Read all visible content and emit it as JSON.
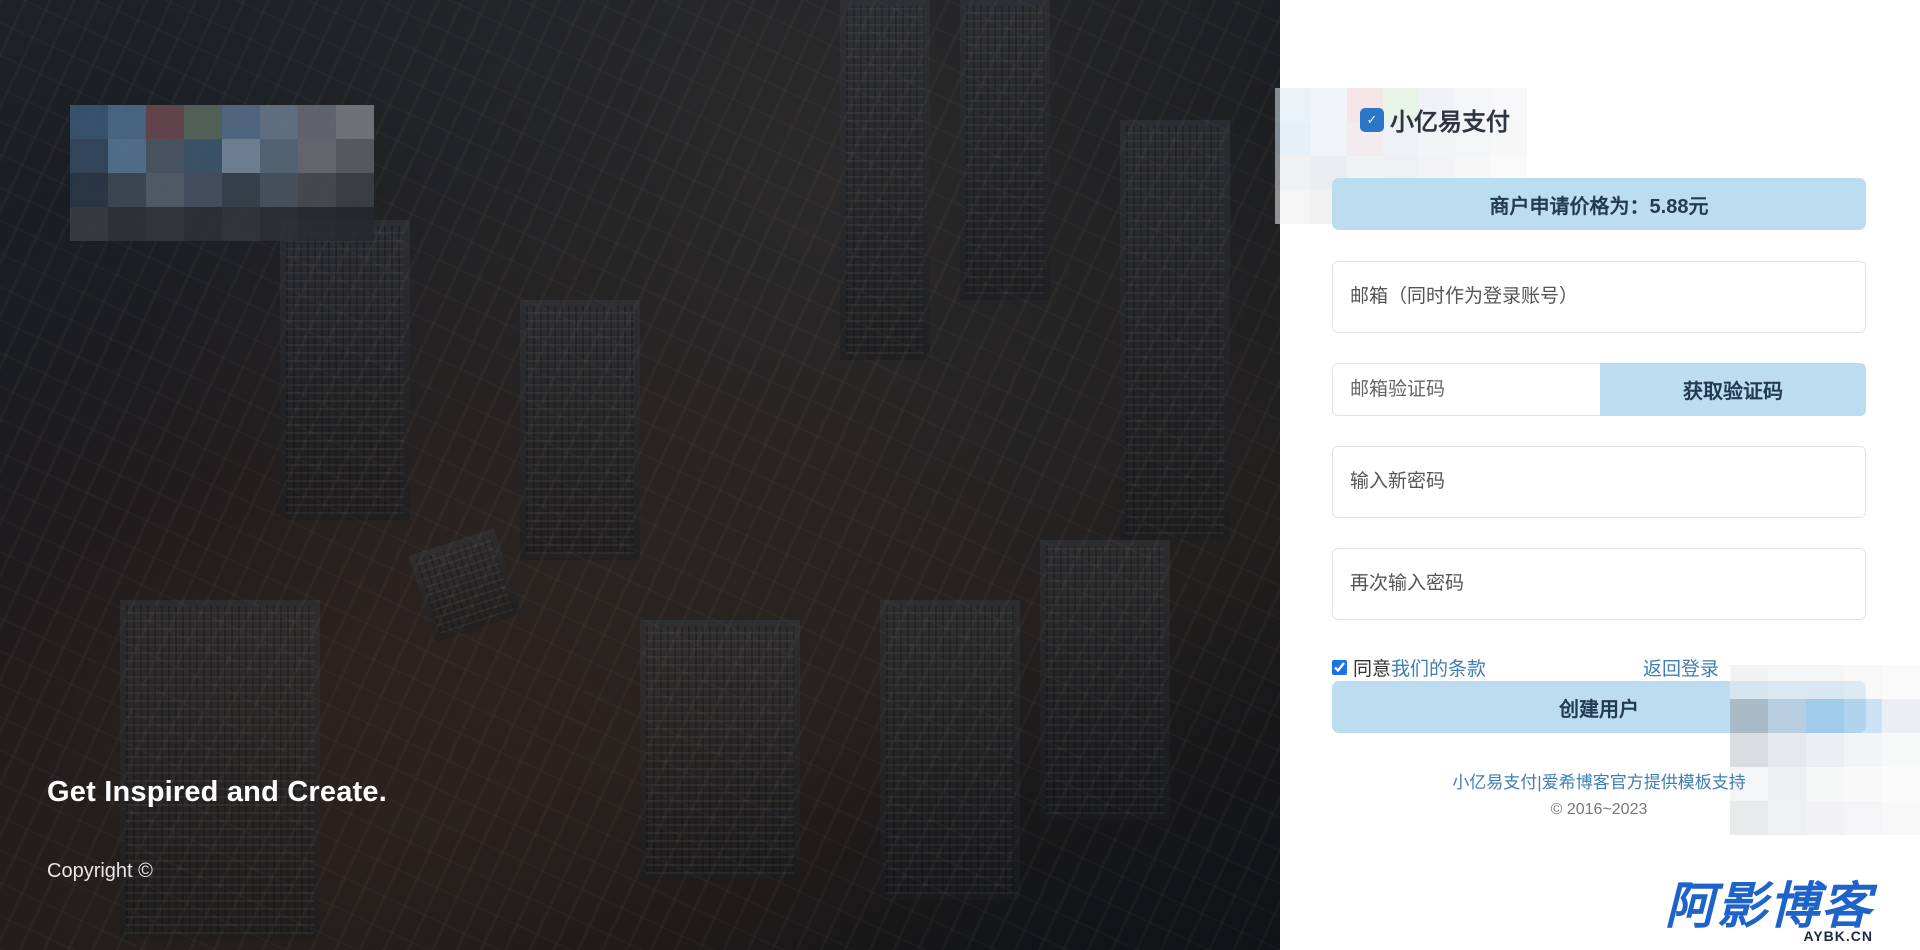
{
  "hero": {
    "tagline": "Get Inspired and Create.",
    "copyright": "Copyright ©"
  },
  "brand": {
    "name": "小亿易支付",
    "icon": "shield-icon"
  },
  "notice": "商户申请价格为：5.88元",
  "form": {
    "email_placeholder": "邮箱（同时作为登录账号）",
    "code_placeholder": "邮箱验证码",
    "get_code_label": "获取验证码",
    "new_password_placeholder": "输入新密码",
    "confirm_password_placeholder": "再次输入密码",
    "agree_text": "同意",
    "terms_link": "我们的条款",
    "back_login": "返回登录",
    "submit_label": "创建用户",
    "agree_checked": true
  },
  "footer": {
    "support_text": "小亿易支付|爱希博客官方提供模板支持",
    "copyright": "© 2016~2023"
  },
  "watermark": {
    "main": "阿影博客",
    "sub": "AYBK.CN"
  },
  "colors": {
    "accent_light": "#bcdcf0",
    "accent_text": "#233a52",
    "link": "#3f7fb3",
    "watermark": "#1d63c9"
  }
}
